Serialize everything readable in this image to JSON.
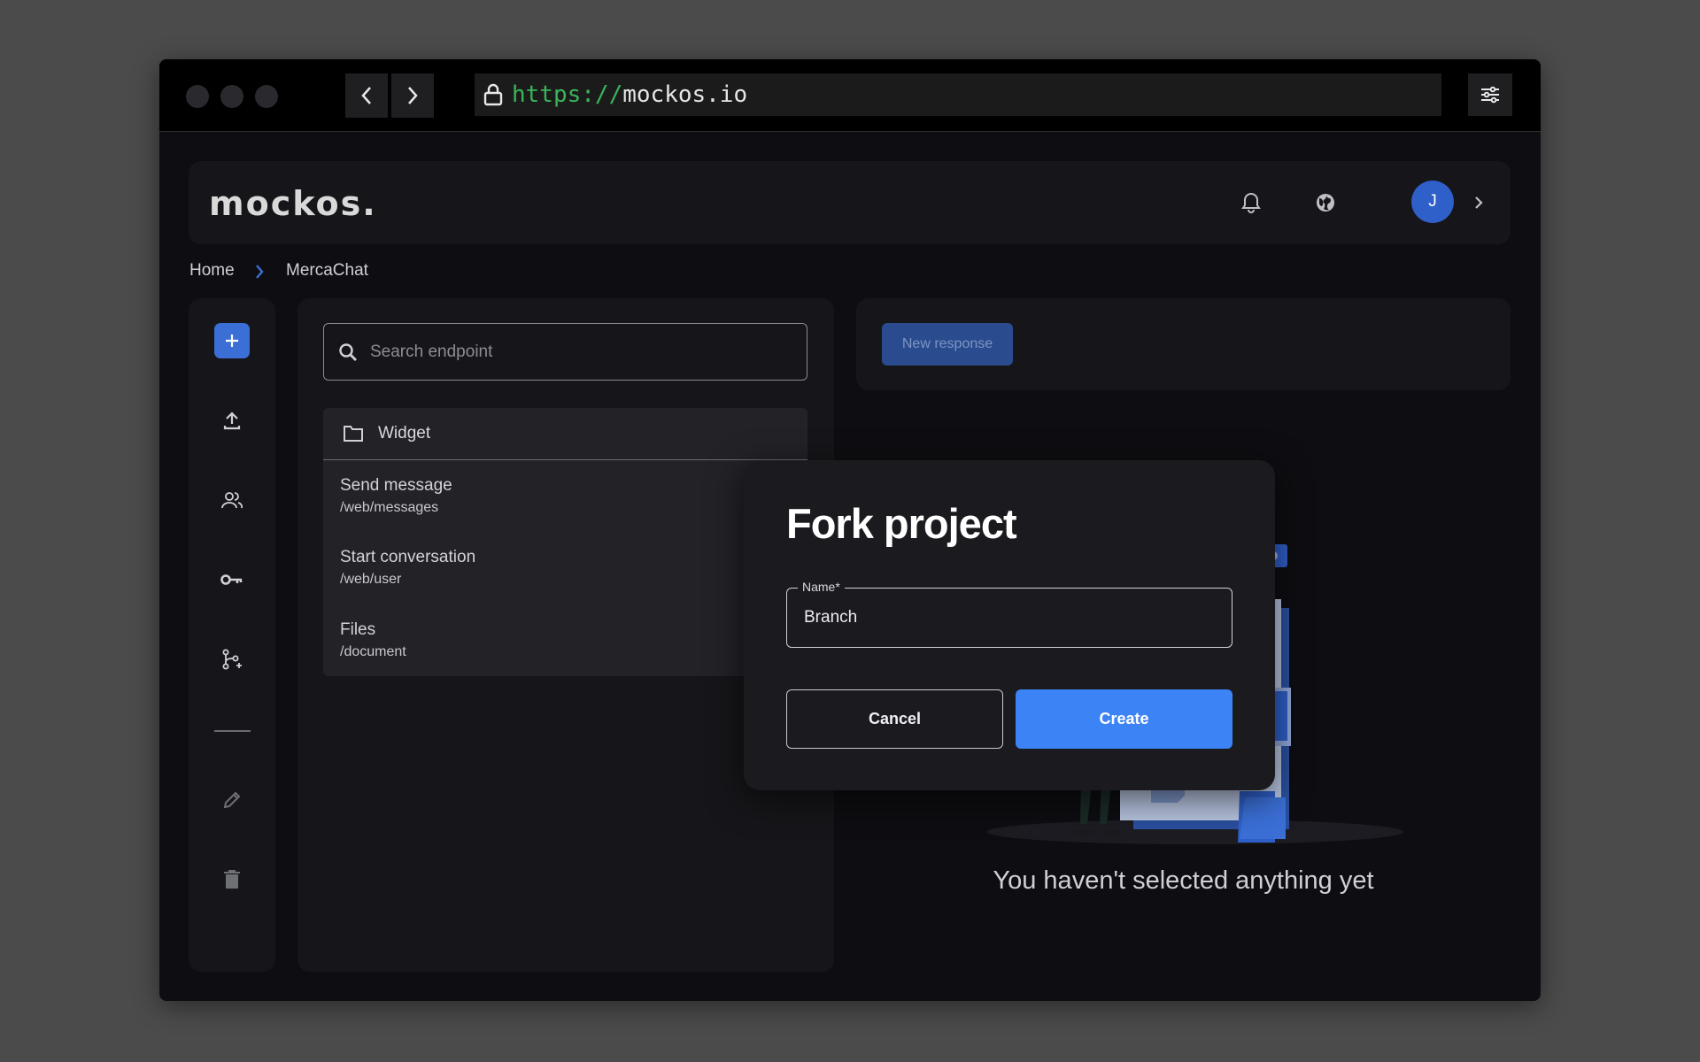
{
  "browser": {
    "url_scheme": "https://",
    "url_host": "mockos.io"
  },
  "header": {
    "logo": "mockos.",
    "avatar_initial": "J"
  },
  "breadcrumb": {
    "items": [
      "Home",
      "MercaChat"
    ],
    "separator_color": "#3b6fd6"
  },
  "endpoints": {
    "search_placeholder": "Search endpoint",
    "folder": "Widget",
    "items": [
      {
        "name": "Send message",
        "path": "/web/messages"
      },
      {
        "name": "Start conversation",
        "path": "/web/user"
      },
      {
        "name": "Files",
        "path": "/document"
      }
    ]
  },
  "response_panel": {
    "new_response_label": "New response",
    "empty_message": "You haven't selected anything yet"
  },
  "modal": {
    "title": "Fork project",
    "name_label": "Name*",
    "name_value": "Branch",
    "cancel_label": "Cancel",
    "create_label": "Create"
  },
  "colors": {
    "accent": "#3c84f5",
    "brand_blue": "#3b6fd6",
    "url_scheme": "#39b55a"
  }
}
